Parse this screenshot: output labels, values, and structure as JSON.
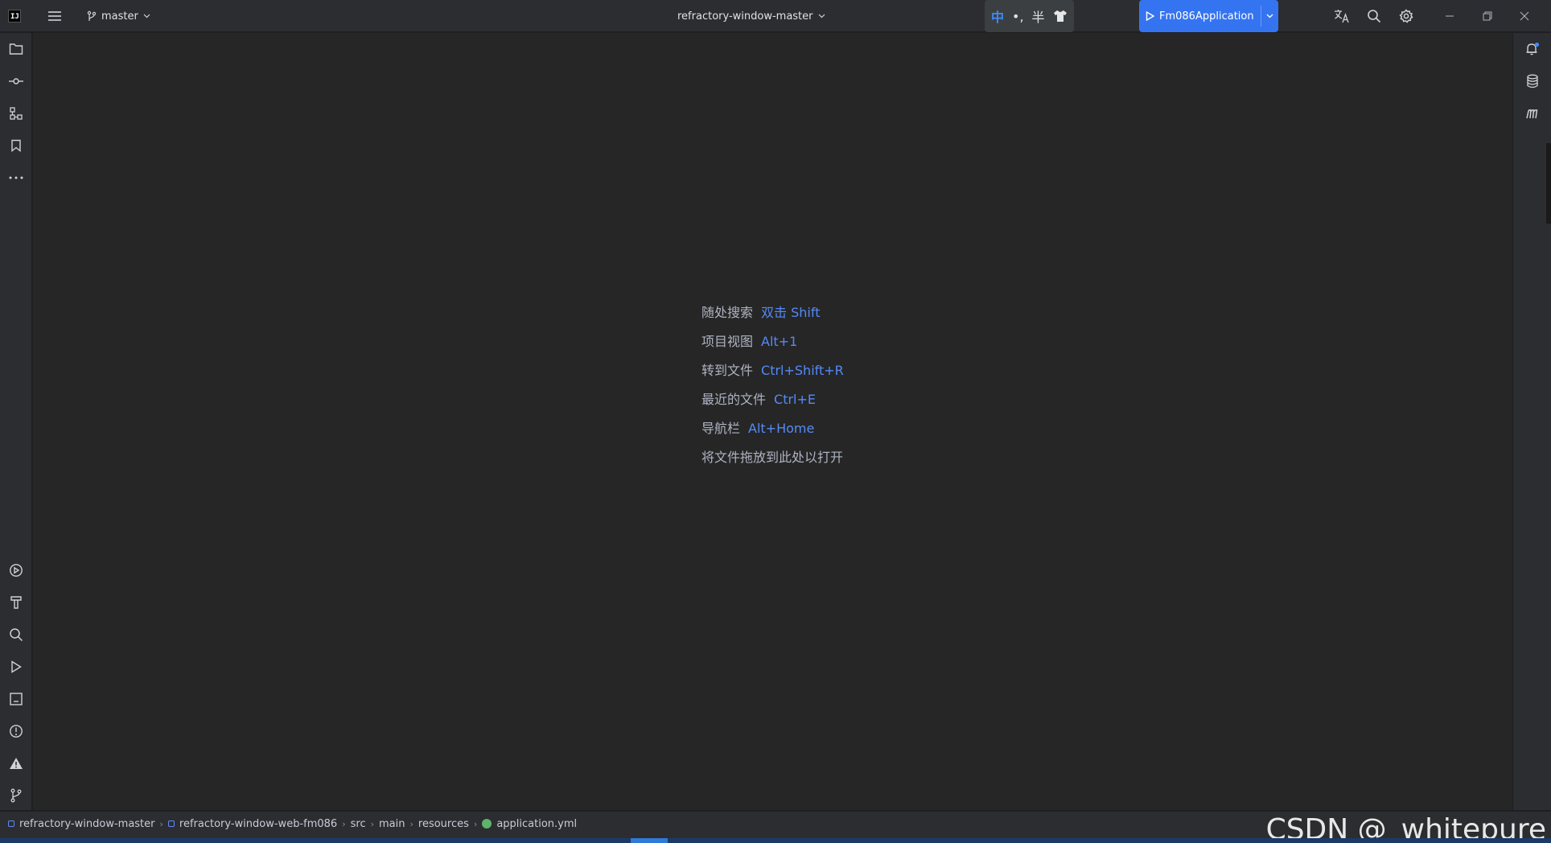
{
  "titlebar": {
    "branch": "master",
    "project": "refractory-window-master",
    "ime": {
      "mode": "中",
      "punct": "•,",
      "width": "半"
    },
    "run_config": "Fm086Application"
  },
  "left_tools": [
    "project-icon",
    "commit-icon",
    "structure-icon",
    "bookmarks-icon",
    "more-icon",
    "services-icon",
    "build-icon",
    "find-icon",
    "run-icon",
    "terminal-icon",
    "problems-icon",
    "warnings-icon",
    "git-icon"
  ],
  "right_tools": [
    "notifications-icon",
    "database-icon",
    "maven-icon"
  ],
  "editor": {
    "hints": [
      {
        "label": "随处搜索",
        "key": "双击 Shift"
      },
      {
        "label": "项目视图",
        "key": "Alt+1"
      },
      {
        "label": "转到文件",
        "key": "Ctrl+Shift+R"
      },
      {
        "label": "最近的文件",
        "key": "Ctrl+E"
      },
      {
        "label": "导航栏",
        "key": "Alt+Home"
      },
      {
        "label": "将文件拖放到此处以打开",
        "key": ""
      }
    ]
  },
  "statusbar": {
    "breadcrumbs": [
      "refractory-window-master",
      "refractory-window-web-fm086",
      "src",
      "main",
      "resources",
      "application.yml"
    ]
  },
  "watermark": "CSDN @_whitepure",
  "colors": {
    "accent": "#3574f0",
    "hint_key": "#548af7",
    "editor_bg": "#262626",
    "chrome_bg": "#2b2d30"
  }
}
